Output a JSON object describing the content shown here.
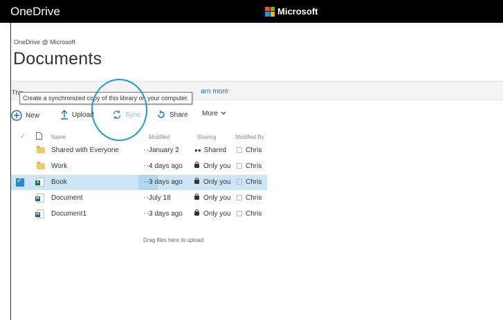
{
  "app": {
    "name": "OneDrive"
  },
  "header": {
    "brand": "Microsoft",
    "logo_colors": [
      "#f25022",
      "#7fba00",
      "#00a4ef",
      "#ffb900"
    ]
  },
  "site": {
    "crumb": "OneDrive @ Microsoft",
    "title": "Documents"
  },
  "infobar": {
    "text_start": "This",
    "link": "arn more"
  },
  "tooltip": {
    "text": "Create a synchronized copy of this library on your computer."
  },
  "commands": {
    "new": "New",
    "upload": "Upload",
    "sync": "Sync",
    "share": "Share",
    "more": "More"
  },
  "columns": {
    "name": "Name",
    "modified": "Modified",
    "sharing": "Sharing",
    "modified_by": "Modified By"
  },
  "files": [
    {
      "type": "folder",
      "name": "Shared with Everyone",
      "modified": "January 2",
      "sharing": "Shared",
      "sharing_icon": "people-icon",
      "modified_by": "Chris",
      "selected": false
    },
    {
      "type": "folder",
      "name": "Work",
      "modified": "4 days ago",
      "sharing": "Only you",
      "sharing_icon": "lock-icon",
      "modified_by": "Chris",
      "selected": false
    },
    {
      "type": "excel",
      "name": "Book",
      "modified": "3 days ago",
      "sharing": "Only you",
      "sharing_icon": "lock-icon",
      "modified_by": "Chris",
      "selected": true
    },
    {
      "type": "word",
      "name": "Document",
      "modified": "July 18",
      "sharing": "Only you",
      "sharing_icon": "lock-icon",
      "modified_by": "Chris",
      "selected": false
    },
    {
      "type": "word",
      "name": "Document1",
      "modified": "3 days ago",
      "sharing": "Only you",
      "sharing_icon": "lock-icon",
      "modified_by": "Chris",
      "selected": false
    }
  ],
  "dropzone": "Drag files here to upload",
  "colors": {
    "accent": "#1a9bd7",
    "selected_row": "#cde6f7",
    "link": "#1d6fb8",
    "excel": "#1e7145",
    "word": "#2b579a"
  }
}
